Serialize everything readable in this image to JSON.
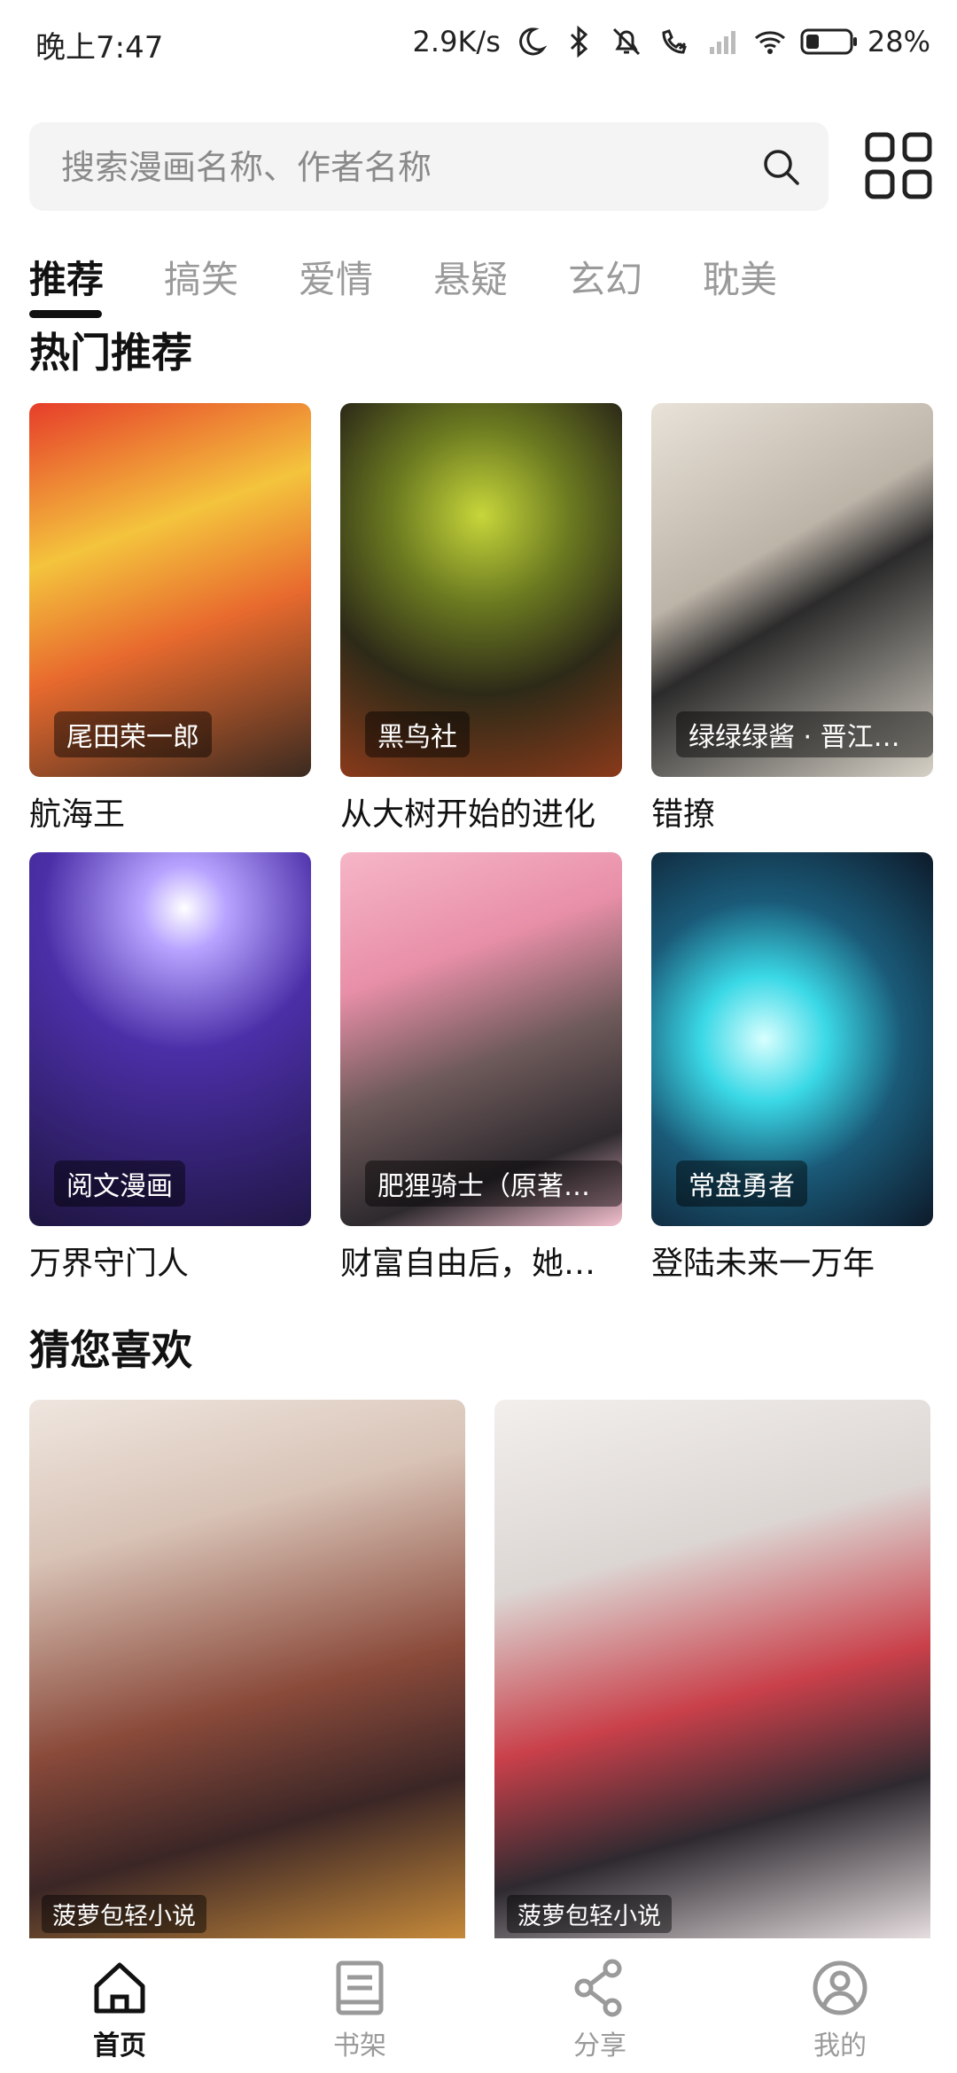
{
  "status_bar": {
    "time": "晚上7:47",
    "network_speed": "2.9K/s",
    "battery": "28%"
  },
  "search": {
    "placeholder": "搜索漫画名称、作者名称"
  },
  "tabs": [
    {
      "label": "推荐",
      "active": true
    },
    {
      "label": "搞笑",
      "active": false
    },
    {
      "label": "爱情",
      "active": false
    },
    {
      "label": "悬疑",
      "active": false
    },
    {
      "label": "玄幻",
      "active": false
    },
    {
      "label": "耽美",
      "active": false
    }
  ],
  "hot": {
    "title": "热门推荐",
    "items": [
      {
        "title": "航海王",
        "author": "尾田荣一郎"
      },
      {
        "title": "从大树开始的进化",
        "author": "黑鸟社"
      },
      {
        "title": "错撩",
        "author": "绿绿绿酱 · 晋江文学城"
      },
      {
        "title": "万界守门人",
        "author": "阅文漫画"
      },
      {
        "title": "财富自由后，她成了所有人的白月光",
        "author": "肥狸骑士（原著：起点）"
      },
      {
        "title": "登陆未来一万年",
        "author": "常盘勇者"
      }
    ]
  },
  "guess": {
    "title": "猜您喜欢",
    "items": [
      {
        "author": "菠萝包轻小说"
      },
      {
        "author": "菠萝包轻小说"
      }
    ]
  },
  "nav": [
    {
      "label": "首页",
      "icon": "home-icon",
      "active": true
    },
    {
      "label": "书架",
      "icon": "bookshelf-icon",
      "active": false
    },
    {
      "label": "分享",
      "icon": "share-icon",
      "active": false
    },
    {
      "label": "我的",
      "icon": "profile-icon",
      "active": false
    }
  ],
  "colors": {
    "active_text": "#111111",
    "inactive_text": "#9a9a9a",
    "search_bg": "#f4f4f4"
  }
}
